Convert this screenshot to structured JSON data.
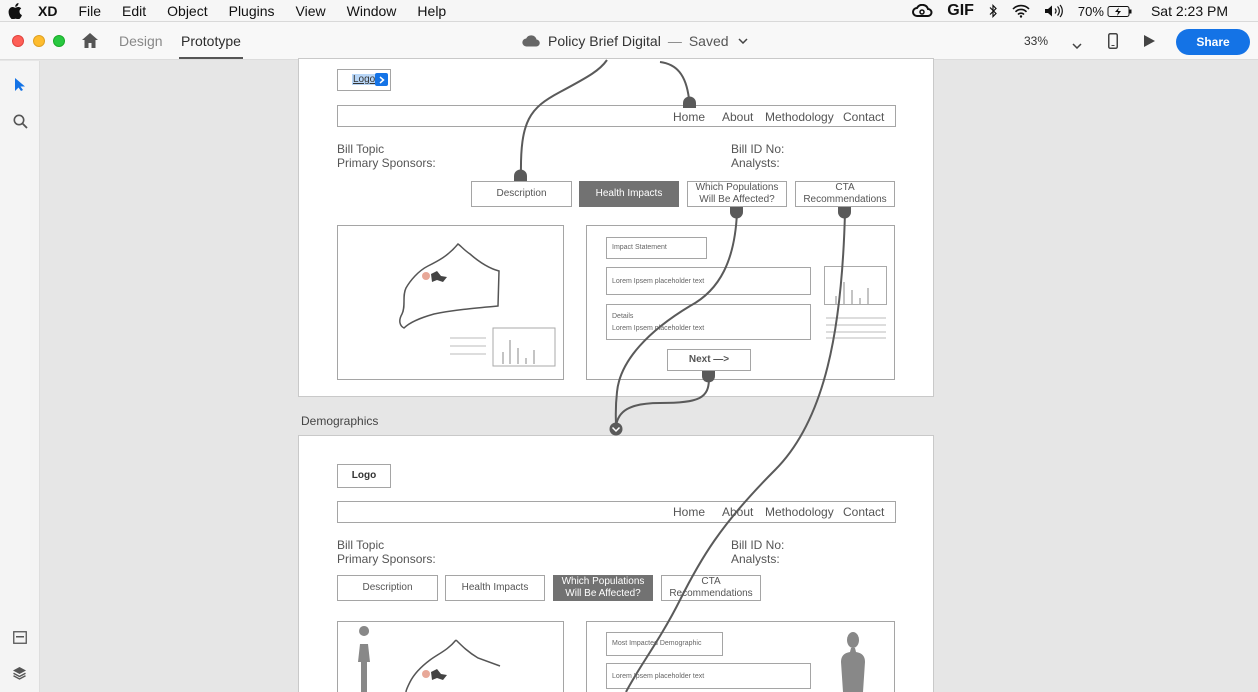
{
  "menubar": {
    "app": "XD",
    "items": [
      "File",
      "Edit",
      "Object",
      "Plugins",
      "View",
      "Window",
      "Help"
    ],
    "status": {
      "gif": "GIF",
      "battery": "70%",
      "clock": "Sat 2:23 PM"
    }
  },
  "toolbar": {
    "tab_design": "Design",
    "tab_prototype": "Prototype",
    "doc_name": "Policy Brief Digital",
    "separator": "—",
    "doc_status": "Saved",
    "zoom": "33%",
    "share": "Share"
  },
  "artboards": [
    {
      "logo": "Logo",
      "nav": [
        "Home",
        "About",
        "Methodology",
        "Contact"
      ],
      "bill_topic": "Bill Topic",
      "primary_sponsors": "Primary Sponsors:",
      "bill_id": "Bill ID No:",
      "analysts": "Analysts:",
      "tabs": [
        "Description",
        "Health Impacts",
        "Which Populations Will Be Affected?",
        "CTA Recommendations"
      ],
      "active_tab": 1,
      "impact_statement": "Impact Statement",
      "placeholder_1": "Lorem Ipsem placeholder text",
      "details": "Details",
      "placeholder_2": "Lorem Ipsem placeholder text",
      "next": "Next —>"
    },
    {
      "label": "Demographics",
      "logo": "Logo",
      "nav": [
        "Home",
        "About",
        "Methodology",
        "Contact"
      ],
      "bill_topic": "Bill Topic",
      "primary_sponsors": "Primary Sponsors:",
      "bill_id": "Bill ID No:",
      "analysts": "Analysts:",
      "tabs": [
        "Description",
        "Health Impacts",
        "Which Populations Will Be Affected?",
        "CTA Recommendations"
      ],
      "active_tab": 2,
      "most_impacted": "Most Impacted Demographic",
      "placeholder_1": "Lorem Ipsem placeholder text"
    }
  ],
  "icons": [
    "apple-icon",
    "creative-cloud-icon",
    "bluetooth-icon",
    "wifi-icon",
    "volume-icon",
    "battery-icon",
    "home-icon",
    "cloud-icon",
    "chevron-down-icon",
    "mobile-preview-icon",
    "play-icon",
    "select-arrow-icon",
    "zoom-icon",
    "assets-icon",
    "layers-icon"
  ],
  "colors": {
    "share": "#1473e6",
    "select_tool": "#1473e6",
    "wire": "#5a5a5a",
    "active_tab": "#727272"
  }
}
